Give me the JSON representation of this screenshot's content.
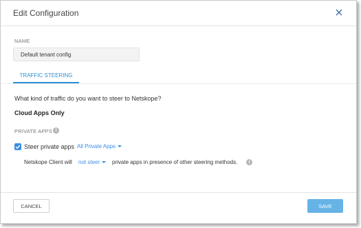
{
  "dialog": {
    "title": "Edit Configuration",
    "close_icon": "close-icon"
  },
  "name_section": {
    "label": "NAME",
    "value": "Default tenant config"
  },
  "tabs": [
    {
      "label": "TRAFFIC STEERING",
      "active": true
    }
  ],
  "traffic": {
    "question": "What kind of traffic do you want to steer to Netskope?",
    "selection": "Cloud Apps Only"
  },
  "private_apps": {
    "label": "PRIVATE APPS",
    "info_icon": "info-icon",
    "steer_checkbox_checked": true,
    "steer_label": "Steer private apps",
    "apps_dropdown": "All Private Apps",
    "client_prefix": "Netskope Client will",
    "steer_mode_dropdown": "not steer",
    "client_suffix": "private apps in presence of other steering methods."
  },
  "footer": {
    "cancel_label": "CANCEL",
    "save_label": "SAVE"
  },
  "colors": {
    "accent": "#2e8fd4",
    "checkbox": "#3a8ee6",
    "save_button": "#66b3e6"
  }
}
